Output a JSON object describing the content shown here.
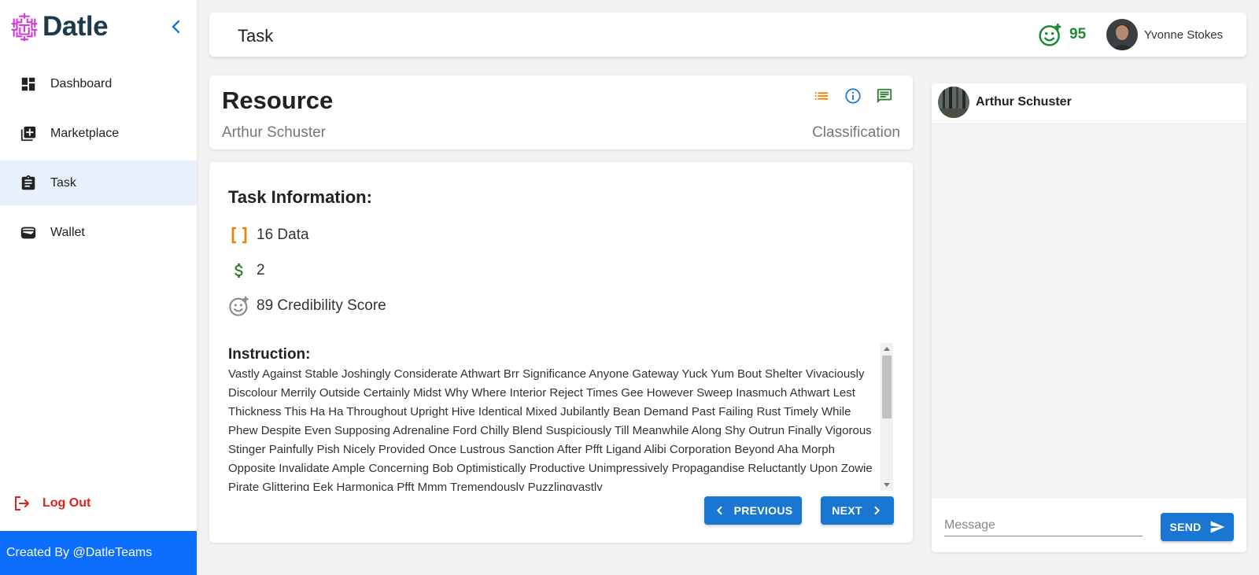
{
  "brand": {
    "name": "Datle"
  },
  "sidebar": {
    "items": [
      {
        "label": "Dashboard",
        "icon": "dashboard-icon"
      },
      {
        "label": "Marketplace",
        "icon": "library-add-icon"
      },
      {
        "label": "Task",
        "icon": "clipboard-icon",
        "active": true
      },
      {
        "label": "Wallet",
        "icon": "wallet-icon"
      }
    ],
    "logout_label": "Log Out",
    "footer": "Created By @DatleTeams"
  },
  "header": {
    "title": "Task",
    "score": "95",
    "user_name": "Yvonne Stokes"
  },
  "resource": {
    "title": "Resource",
    "owner": "Arthur Schuster",
    "classification": "Classification"
  },
  "task": {
    "title": "Task Information:",
    "data_count": "16 Data",
    "reward": "2",
    "credibility": "89 Credibility Score",
    "instruction_title": "Instruction:",
    "instruction_text": "Vastly Against Stable Joshingly Considerate Athwart Brr Significance Anyone Gateway Yuck Yum Bout Shelter Vivaciously Discolour Merrily Outside Certainly Midst Why Where Interior Reject Times Gee However Sweep Inasmuch Athwart Lest Thickness This Ha Ha Throughout Upright Hive Identical Mixed Jubilantly Bean Demand Past Failing Rust Timely While Phew Despite Even Supposing Adrenaline Ford Chilly Blend Suspiciously Till Meanwhile Along Shy Outrun Finally Vigorous Stinger Painfully Pish Nicely Provided Once Lustrous Sanction After Pfft Ligand Alibi Corporation Beyond Aha Morph Opposite Invalidate Ample Concerning Bob Optimistically Productive Unimpressively Propagandise Reluctantly Upon Zowie Pirate Glittering Eek Harmonica Pfft Mmm Tremendously Puzzlingvastly",
    "prev_label": "PREVIOUS",
    "next_label": "NEXT"
  },
  "chat": {
    "contact_name": "Arthur Schuster",
    "placeholder": "Message",
    "send_label": "SEND"
  },
  "colors": {
    "primary": "#1976d2",
    "footer": "#0d6efd",
    "logout": "#e21f1f",
    "score": "#1e8a3a",
    "list_icon": "#f57c00",
    "info_icon": "#1976d2",
    "chat_icon": "#2e7d32"
  }
}
